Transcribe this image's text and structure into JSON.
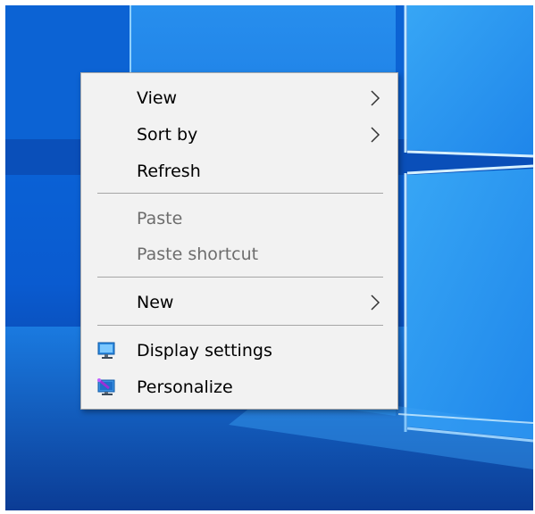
{
  "menu": {
    "items": [
      {
        "label": "View",
        "has_submenu": true,
        "enabled": true
      },
      {
        "label": "Sort by",
        "has_submenu": true,
        "enabled": true
      },
      {
        "label": "Refresh",
        "has_submenu": false,
        "enabled": true
      },
      {
        "label": "Paste",
        "has_submenu": false,
        "enabled": false
      },
      {
        "label": "Paste shortcut",
        "has_submenu": false,
        "enabled": false
      },
      {
        "label": "New",
        "has_submenu": true,
        "enabled": true
      },
      {
        "label": "Display settings",
        "has_submenu": false,
        "enabled": true,
        "icon": "display-icon"
      },
      {
        "label": "Personalize",
        "has_submenu": false,
        "enabled": true,
        "icon": "personalize-icon"
      }
    ]
  },
  "colors": {
    "menu_background": "#f2f2f2",
    "menu_text": "#000000",
    "disabled_text": "#6d6d6d",
    "desktop_accent": "#0a5bd0"
  }
}
